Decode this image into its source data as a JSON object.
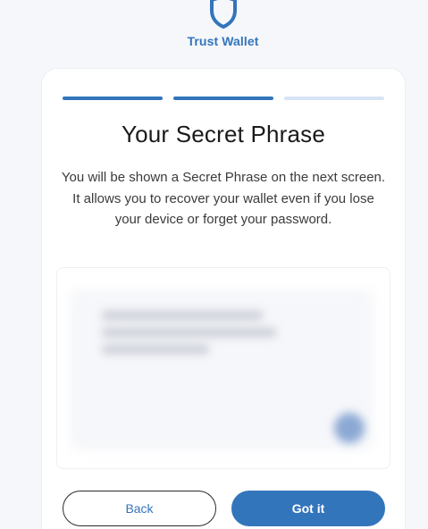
{
  "brand": {
    "name": "Trust Wallet",
    "color": "#3375bb"
  },
  "progress": {
    "steps_total": 3,
    "steps_done": 2
  },
  "main": {
    "title": "Your Secret Phrase",
    "description": "You will be shown a Secret Phrase on the next screen. It allows you to recover your wallet even if you lose your device or forget your password."
  },
  "actions": {
    "back_label": "Back",
    "confirm_label": "Got it"
  }
}
